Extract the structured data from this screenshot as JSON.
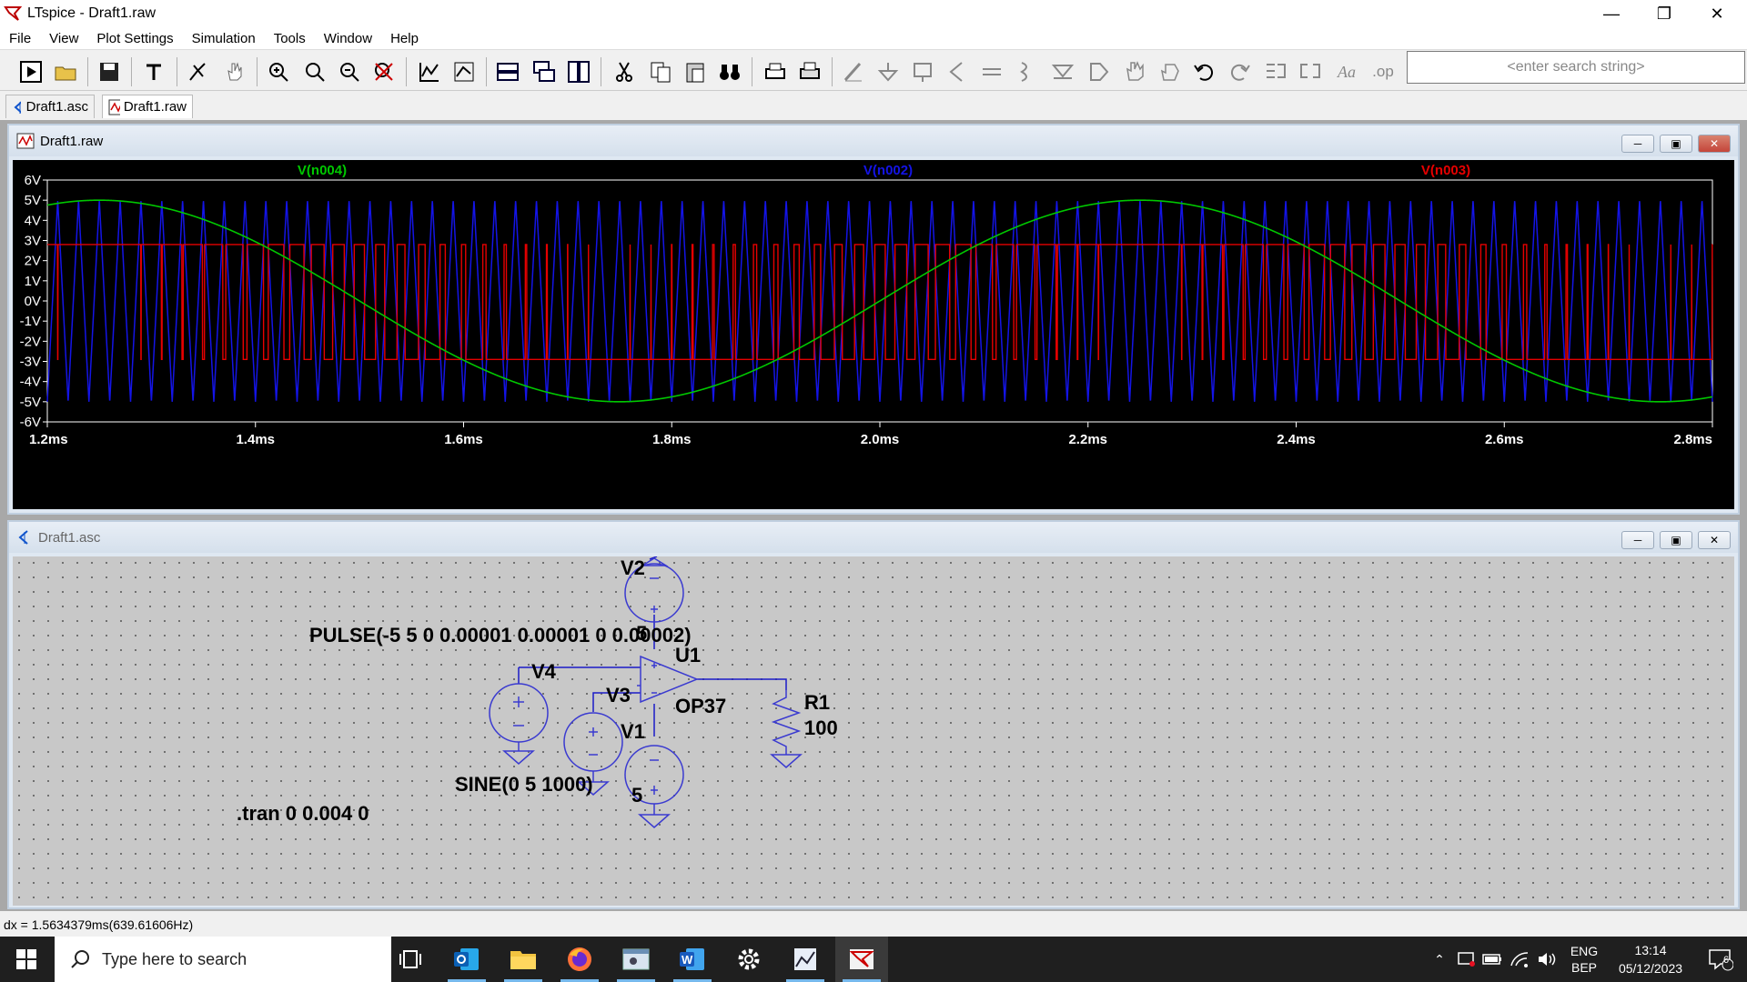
{
  "window": {
    "title": "LTspice - Draft1.raw"
  },
  "menu": [
    "File",
    "View",
    "Plot Settings",
    "Simulation",
    "Tools",
    "Window",
    "Help"
  ],
  "search": {
    "placeholder": "<enter search string>"
  },
  "tabs": [
    {
      "label": "Draft1.asc",
      "icon": "schematic-icon"
    },
    {
      "label": "Draft1.raw",
      "icon": "waveform-icon"
    }
  ],
  "plot_window": {
    "title": "Draft1.raw"
  },
  "schematic_window": {
    "title": "Draft1.asc"
  },
  "chart_data": {
    "type": "line",
    "x_unit": "ms",
    "xlim": [
      1.2,
      2.8
    ],
    "ylim": [
      -6,
      6
    ],
    "x_ticks": [
      "1.2ms",
      "1.4ms",
      "1.6ms",
      "1.8ms",
      "2.0ms",
      "2.2ms",
      "2.4ms",
      "2.6ms",
      "2.8ms"
    ],
    "y_ticks": [
      "6V",
      "5V",
      "4V",
      "3V",
      "2V",
      "1V",
      "0V",
      "-1V",
      "-2V",
      "-3V",
      "-4V",
      "-5V",
      "-6V"
    ],
    "grid": false,
    "background": "#000000",
    "series": [
      {
        "name": "V(n004)",
        "color": "#00c800",
        "kind": "sine",
        "amplitude": 5,
        "offset": 0,
        "frequency_hz": 1000
      },
      {
        "name": "V(n002)",
        "color": "#1414e6",
        "kind": "triangle",
        "low": -5,
        "high": 5,
        "period_ms": 0.02
      },
      {
        "name": "V(n003)",
        "color": "#e60000",
        "kind": "pwm",
        "high": 2.8,
        "low": -2.9,
        "reference": "V(n004)",
        "carrier": "V(n002)"
      }
    ]
  },
  "schematic": {
    "labels": {
      "v2": "V2",
      "v2_value": "5",
      "pulse": "PULSE(-5 5 0 0.00001 0.00001 0 0.00002)",
      "u1": "U1",
      "op37": "OP37",
      "v4": "V4",
      "v3": "V3",
      "v1": "V1",
      "v1_value": "5",
      "r1": "R1",
      "r1_value": "100",
      "sine": "SINE(0 5 1000)",
      "tran": ".tran 0 0.004 0"
    }
  },
  "status": {
    "text": "dx = 1.5634379ms(639.61606Hz)"
  },
  "taskbar": {
    "search_placeholder": "Type here to search",
    "lang": "ENG",
    "layout": "BEP",
    "time": "13:14",
    "date": "05/12/2023",
    "notifications": "6"
  }
}
